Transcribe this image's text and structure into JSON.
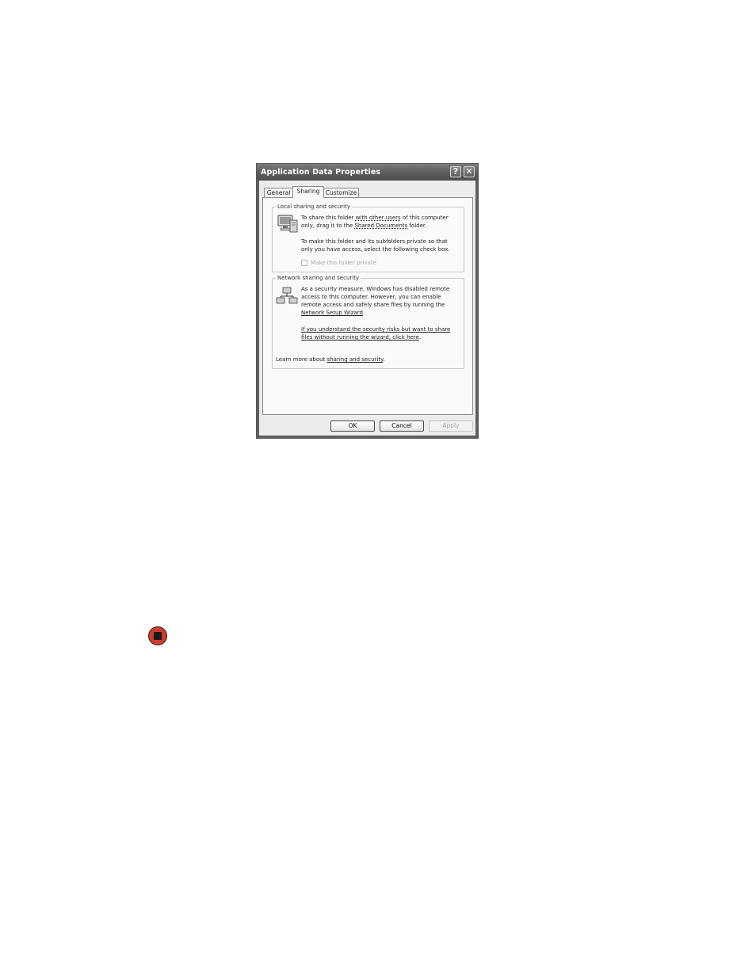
{
  "dialog": {
    "title": "Application Data Properties",
    "help_icon": "question-icon",
    "close_icon": "close-icon",
    "tabs": [
      {
        "label": "General"
      },
      {
        "label": "Sharing"
      },
      {
        "label": "Customize"
      }
    ],
    "local": {
      "legend": "Local sharing and security",
      "icon": "computer-folder-icon",
      "p1_prefix": "To share this folder",
      "p1_link1": "with other users",
      "p1_mid": "of this computer",
      "p1_line2_prefix": "only, drag it to the",
      "p1_link2": "Shared Documents",
      "p1_suffix": "folder.",
      "p2_line1": "To make this folder and its subfolders private so that",
      "p2_line2": "only you have access, select the following check box.",
      "checkbox_label": "Make this folder private"
    },
    "network": {
      "legend": "Network sharing and security",
      "icon": "network-computers-icon",
      "line1": "As a security measure, Windows has disabled remote",
      "line2": "access to this computer. However, you can enable",
      "line3": "remote access and safely share files by running the",
      "wizard_link": "Network Setup Wizard",
      "wizard_suffix": ".",
      "risk_line1": "If you understand the security risks but want to share",
      "risk_line2": "files without running the wizard, click here",
      "risk_suffix": ".",
      "learn_prefix": "Learn more about",
      "learn_link": "sharing and security",
      "learn_suffix": "."
    },
    "buttons": {
      "ok": "OK",
      "cancel": "Cancel",
      "apply": "Apply"
    }
  },
  "stop_icon": {
    "name": "stop-icon",
    "color": "#d13b2b"
  }
}
